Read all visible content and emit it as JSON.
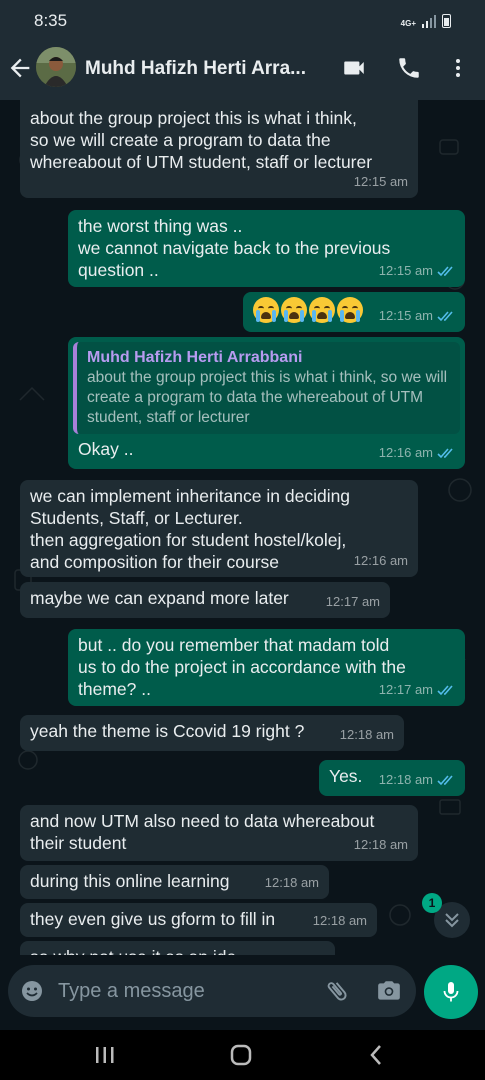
{
  "status_bar": {
    "time": "8:35",
    "network": "4G+"
  },
  "header": {
    "contact_name": "Muhd Hafizh Herti Arra..."
  },
  "icons": {
    "back": "arrow-left-icon",
    "video": "video-call-icon",
    "call": "phone-icon",
    "menu": "more-vertical-icon",
    "emoji": "emoji-icon",
    "attach": "paperclip-icon",
    "camera": "camera-icon",
    "mic": "mic-icon",
    "scroll_down": "chevron-double-down-icon"
  },
  "colors": {
    "incoming_bubble": "#1f2c33",
    "outgoing_bubble": "#005c4b",
    "accent": "#00a884",
    "read_ticks": "#53bdeb",
    "quote_author": "#b79bf0"
  },
  "messages": [
    {
      "direction": "in",
      "text": "about the group project this is what i think,\nso we will create a program to data the\nwhereabout of UTM student, staff or lecturer",
      "time": "12:15 am"
    },
    {
      "direction": "out",
      "text": "the worst thing was ..\nwe cannot navigate back to the previous\nquestion ..",
      "time": "12:15 am",
      "status": "read"
    },
    {
      "direction": "out",
      "emoji": "loudly-crying-face x4",
      "time": "12:15 am",
      "status": "read"
    },
    {
      "direction": "out",
      "quote": {
        "author": "Muhd Hafizh Herti Arrabbani",
        "text": "about the group project this is what i think, so we will create a program to data the whereabout of UTM student, staff or lecturer"
      },
      "text": "Okay ..",
      "time": "12:16 am",
      "status": "read"
    },
    {
      "direction": "in",
      "text": "we can implement inheritance in deciding\nStudents, Staff, or Lecturer.\nthen aggregation for student hostel/kolej,\nand composition for their course",
      "time": "12:16 am"
    },
    {
      "direction": "in",
      "text": "maybe we can expand more later",
      "time": "12:17 am"
    },
    {
      "direction": "out",
      "text": "but .. do you remember that madam told\nus to do the project in accordance with the\ntheme? ..",
      "time": "12:17 am",
      "status": "read"
    },
    {
      "direction": "in",
      "text": "yeah the theme is Ccovid 19 right ?",
      "time": "12:18 am"
    },
    {
      "direction": "out",
      "text": "Yes.",
      "time": "12:18 am",
      "status": "read"
    },
    {
      "direction": "in",
      "text": "and now UTM also need to data whereabout\ntheir student",
      "time": "12:18 am"
    },
    {
      "direction": "in",
      "text": "during this online learning",
      "time": "12:18 am"
    },
    {
      "direction": "in",
      "text": "they even give us gform to fill in",
      "time": "12:18 am"
    },
    {
      "direction": "in",
      "text": "so why not use it as an ide",
      "time": ""
    }
  ],
  "scroll_badge": {
    "unread": "1"
  },
  "composer": {
    "placeholder": "Type a message"
  }
}
